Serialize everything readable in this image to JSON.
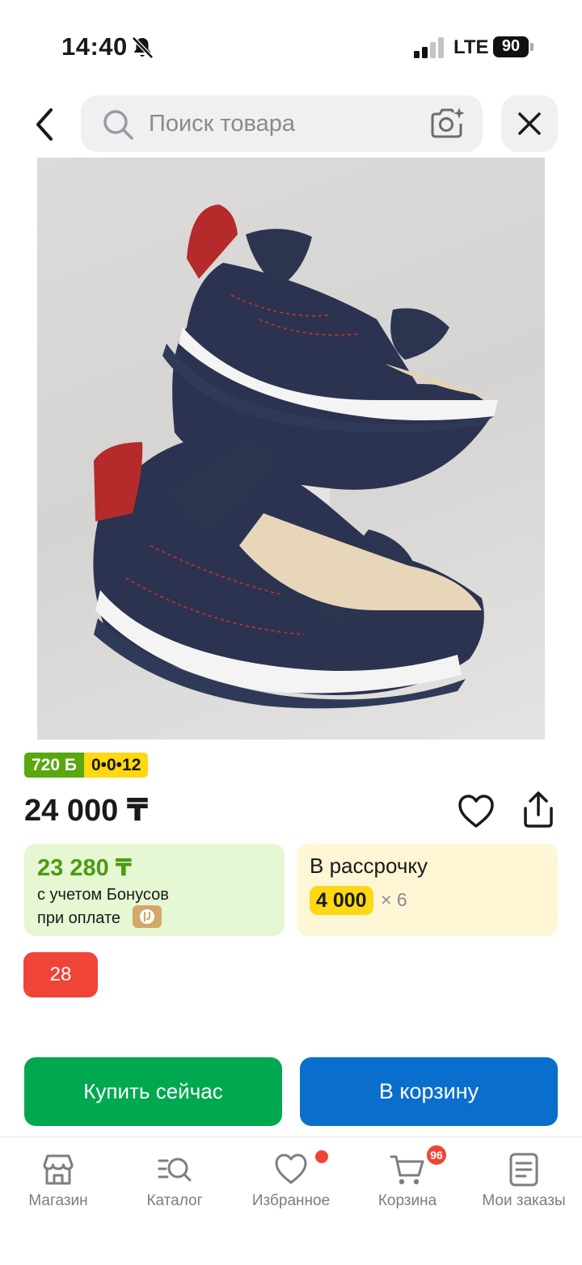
{
  "status_bar": {
    "time": "14:40",
    "network": "LTE",
    "battery": "90"
  },
  "search": {
    "placeholder": "Поиск товара"
  },
  "product": {
    "image_icon": "sandals-photo",
    "badges": {
      "bonus": "720 Б",
      "installment": "0•0•12"
    },
    "price": "24 000 ₸"
  },
  "bonus_card": {
    "price": "23 280 ₸",
    "line1": "с учетом Бонусов",
    "line2": "при оплате"
  },
  "installment_card": {
    "title": "В рассрочку",
    "amount": "4 000",
    "months": "× 6"
  },
  "size_chip": "28",
  "actions": {
    "buy_now": "Купить сейчас",
    "add_to_cart": "В корзину"
  },
  "colors": {
    "buy_now": "#00a84f",
    "add_to_cart": "#0a6fcc",
    "bonus_green": "#5aa70f",
    "installment_yellow": "#ffd814",
    "size_red": "#f04438"
  },
  "nav": {
    "items": [
      {
        "label": "Магазин",
        "icon": "store-icon"
      },
      {
        "label": "Каталог",
        "icon": "catalog-icon"
      },
      {
        "label": "Избранное",
        "icon": "heart-icon"
      },
      {
        "label": "Корзина",
        "icon": "cart-icon"
      },
      {
        "label": "Мои заказы",
        "icon": "orders-icon"
      }
    ],
    "cart_count": "96"
  }
}
